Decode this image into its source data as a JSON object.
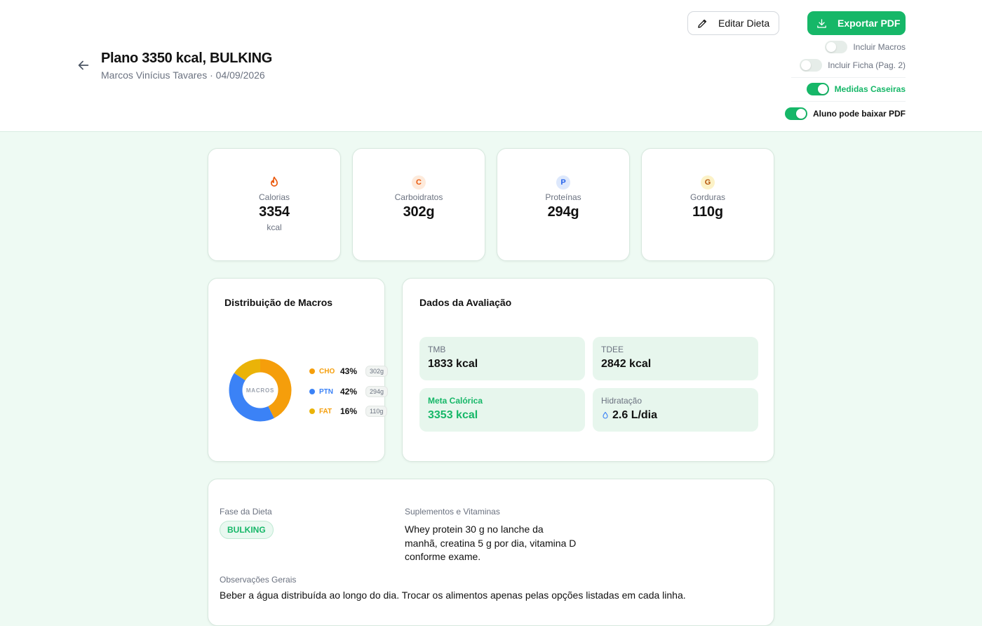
{
  "header": {
    "title": "Plano 3350 kcal, BULKING",
    "subtitle": "Marcos Vinícius Tavares · 04/09/2026",
    "edit_label": "Editar Dieta",
    "export_label": "Exportar PDF"
  },
  "toggles": [
    {
      "label": "Incluir Macros",
      "on": false
    },
    {
      "label": "Incluir Ficha (Pag. 2)",
      "on": false
    },
    {
      "label": "Medidas Caseiras",
      "on": true
    },
    {
      "label": "Aluno pode baixar PDF",
      "on": true
    }
  ],
  "stats": [
    {
      "icon": "flame-icon",
      "label": "Calorias",
      "value": "3354",
      "unit": "kcal"
    },
    {
      "icon": "C",
      "label": "Carboidratos",
      "value": "302g"
    },
    {
      "icon": "P",
      "label": "Proteínas",
      "value": "294g"
    },
    {
      "icon": "G",
      "label": "Gorduras",
      "value": "110g"
    }
  ],
  "macros": {
    "title": "Distribuição de Macros",
    "center_label": "MACROS",
    "items": [
      {
        "tag": "CHO",
        "pct": "43%",
        "grams": "302g",
        "value": 43,
        "color": "#f59e0b"
      },
      {
        "tag": "PTN",
        "pct": "42%",
        "grams": "294g",
        "value": 42,
        "color": "#3b82f6"
      },
      {
        "tag": "FAT",
        "pct": "16%",
        "grams": "110g",
        "value": 16,
        "color": "#eab308"
      }
    ]
  },
  "evaluation": {
    "title": "Dados da Avaliação",
    "tmb_label": "TMB",
    "tmb_value": "1833 kcal",
    "tdee_label": "TDEE",
    "tdee_value": "2842 kcal",
    "goal_label": "Meta Calórica",
    "goal_value": "3353 kcal",
    "hydration_label": "Hidratação",
    "hydration_value": "2.6 L/dia"
  },
  "details": {
    "phase_label": "Fase da Dieta",
    "phase_value": "BULKING",
    "supplements_label": "Suplementos e Vitaminas",
    "supplements_line1": "Whey protein 30 g no lanche da",
    "supplements_line2": "manhã, creatina 5 g por dia, vitamina D",
    "supplements_line3": "conforme exame.",
    "notes_label": "Observações Gerais",
    "notes_value": "Beber a água distribuída ao longo do dia. Trocar os alimentos apenas pelas opções listadas em cada linha."
  },
  "colors": {
    "accent": "#16b768",
    "cho": "#f59e0b",
    "ptn": "#3b82f6",
    "fat": "#eab308"
  }
}
